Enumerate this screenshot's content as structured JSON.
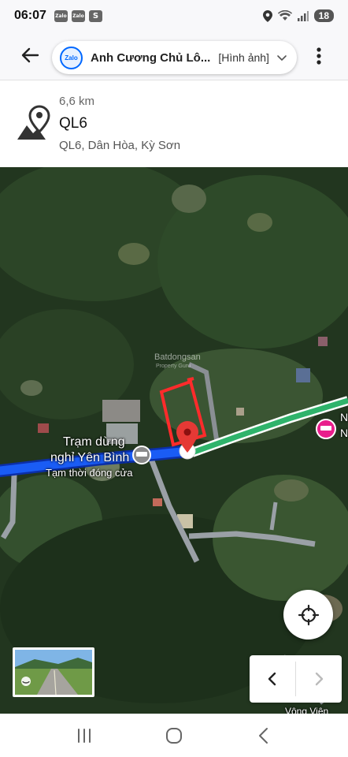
{
  "status_bar": {
    "time": "06:07",
    "apps": [
      "Zalo",
      "Zalo",
      "S"
    ],
    "battery": "18",
    "icons": [
      "location-icon",
      "wifi-icon",
      "signal-icon"
    ]
  },
  "top_bar": {
    "back_icon": "arrow-left-icon",
    "chat_logo": "Zalo",
    "title": "Anh Cương Chủ Lô...",
    "tag": "[Hình ảnh]",
    "more_icon": "more-vertical-icon"
  },
  "info": {
    "distance": "6,6 km",
    "name": "QL6",
    "address": "QL6, Dân Hòa, Kỳ Sơn"
  },
  "map": {
    "poi_name_line1": "Trạm dừng",
    "poi_name_line2": "nghỉ Yên Bình",
    "poi_status": "Tạm thời đóng cửa",
    "watermark": "Batdongsan",
    "watermark_sub": "Property Guru",
    "edge_label_1": "N",
    "edge_label_2": "N",
    "bottom_label": "Vông Viên"
  },
  "controls": {
    "locate_icon": "crosshair-icon",
    "prev_icon": "chevron-left-icon",
    "next_icon": "chevron-right-icon"
  },
  "system_nav": [
    "recents-icon",
    "home-icon",
    "back-icon"
  ],
  "colors": {
    "route_blue": "#1a5cf5",
    "road_green": "#2fb36b",
    "pin_red": "#e53935",
    "hotel_pink": "#e91e8c",
    "plot_outline": "#ff2b2b"
  }
}
